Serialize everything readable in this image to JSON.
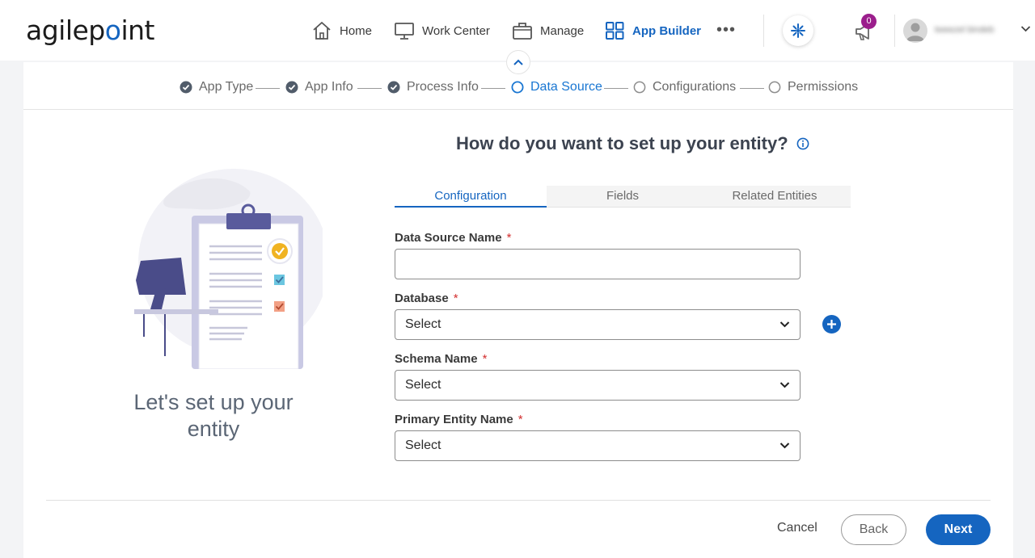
{
  "header": {
    "logo_text": "agilepoint",
    "nav": [
      {
        "label": "Home",
        "icon": "home-icon"
      },
      {
        "label": "Work Center",
        "icon": "monitor-icon"
      },
      {
        "label": "Manage",
        "icon": "briefcase-icon"
      },
      {
        "label": "App Builder",
        "icon": "grid-icon",
        "active": true
      }
    ],
    "more_label": "•••",
    "notification_count": "0",
    "user_name": "tweezel bindeb",
    "accent_color": "#1565c0",
    "badge_color": "#9b1e8c"
  },
  "stepper": {
    "steps": [
      {
        "label": "App Type",
        "state": "done"
      },
      {
        "label": "App Info",
        "state": "done"
      },
      {
        "label": "Process Info",
        "state": "done"
      },
      {
        "label": "Data Source",
        "state": "current"
      },
      {
        "label": "Configurations",
        "state": "todo"
      },
      {
        "label": "Permissions",
        "state": "todo"
      }
    ]
  },
  "left_panel": {
    "title": "Let's set up your entity"
  },
  "form": {
    "heading": "How do you want to set up your entity?",
    "tabs": [
      {
        "label": "Configuration",
        "active": true
      },
      {
        "label": "Fields",
        "active": false
      },
      {
        "label": "Related Entities",
        "active": false
      }
    ],
    "fields": {
      "data_source_name": {
        "label": "Data Source Name",
        "required": "*",
        "value": "",
        "placeholder": ""
      },
      "database": {
        "label": "Database",
        "required": "*",
        "value": "Select"
      },
      "schema_name": {
        "label": "Schema Name",
        "required": "*",
        "value": "Select"
      },
      "primary_entity_name": {
        "label": "Primary Entity Name",
        "required": "*",
        "value": "Select"
      }
    }
  },
  "footer": {
    "cancel_label": "Cancel",
    "back_label": "Back",
    "next_label": "Next"
  }
}
